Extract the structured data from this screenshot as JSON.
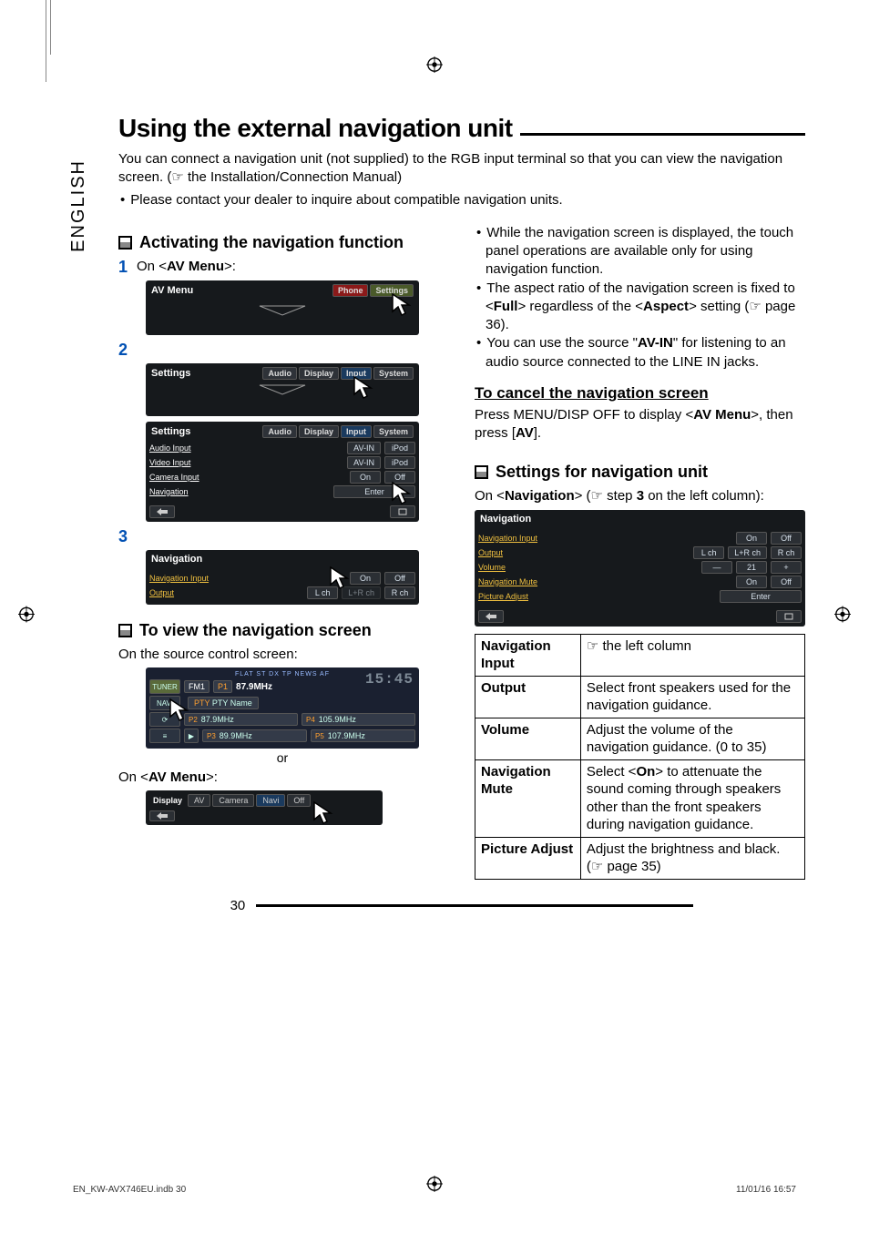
{
  "side_tab": "ENGLISH",
  "title": "Using the external navigation unit",
  "intro_line": "You can connect a navigation unit (not supplied) to the RGB input terminal so that you can view the navigation screen. (☞ the Installation/Connection Manual)",
  "intro_bullet": "Please contact your dealer to inquire about compatible navigation units.",
  "left": {
    "activating_heading": "Activating the navigation function",
    "step1_num": "1",
    "step1_text_pre": "On <",
    "step1_bold": "AV Menu",
    "step1_text_post": ">:",
    "avmenu": {
      "title": "AV Menu",
      "phone": "Phone",
      "settings": "Settings"
    },
    "step2_num": "2",
    "settings_top": {
      "title": "Settings",
      "tabs": [
        "Audio",
        "Display",
        "Input",
        "System"
      ]
    },
    "settings_input": {
      "title": "Settings",
      "tabs": [
        "Audio",
        "Display",
        "Input",
        "System"
      ],
      "rows": [
        {
          "label": "Audio Input",
          "opts": [
            "AV-IN",
            "iPod"
          ]
        },
        {
          "label": "Video Input",
          "opts": [
            "AV-IN",
            "iPod"
          ]
        },
        {
          "label": "Camera Input",
          "opts": [
            "On",
            "Off"
          ]
        },
        {
          "label": "Navigation",
          "enter": "Enter"
        }
      ]
    },
    "step3_num": "3",
    "navigation_shot": {
      "title": "Navigation",
      "rows": [
        {
          "label": "Navigation Input",
          "opts": [
            "On",
            "Off"
          ]
        },
        {
          "label": "Output",
          "opts": [
            "L ch",
            "L+R ch",
            "R ch"
          ]
        }
      ]
    },
    "view_heading": "To view the navigation screen",
    "view_intro": "On the source control screen:",
    "tuner": {
      "side": [
        "TUNER",
        "NAVI",
        "",
        ""
      ],
      "band": "FM1",
      "preset1": "P1",
      "freq_main": "87.9MHz",
      "pty": "PTY Name",
      "presets": [
        {
          "n": "P2",
          "v": "87.9MHz"
        },
        {
          "n": "P4",
          "v": "105.9MHz"
        },
        {
          "n": "P3",
          "v": "89.9MHz"
        },
        {
          "n": "P5",
          "v": "107.9MHz"
        }
      ],
      "clock": "15:45",
      "indicators": "FLAT  ST  DX  TP  NEWS  AF"
    },
    "or": "or",
    "view_avmenu_pre": "On <",
    "view_avmenu_bold": "AV Menu",
    "view_avmenu_post": ">:",
    "display_shot": {
      "label": "Display",
      "tabs": [
        "AV",
        "Camera",
        "Navi",
        "Off"
      ]
    }
  },
  "right": {
    "bullets": [
      "While the navigation screen is displayed, the touch panel operations are available only for using navigation function.",
      "The aspect ratio of the navigation screen is fixed to <__B__Full__/B__> regardless of the <__B__Aspect__/B__> setting (☞ page 36).",
      "You can use the source \"__B__AV-IN__/B__\" for listening to an audio source connected to the LINE IN jacks."
    ],
    "cancel_heading": "To cancel the navigation screen",
    "cancel_body_pre": "Press MENU/DISP OFF to display <",
    "cancel_body_bold": "AV Menu",
    "cancel_body_mid": ">, then press [",
    "cancel_body_bold2": "AV",
    "cancel_body_post": "].",
    "settings_heading": "Settings for navigation unit",
    "settings_intro_pre": "On <",
    "settings_intro_bold": "Navigation",
    "settings_intro_mid": "> (☞ step ",
    "settings_intro_bold2": "3",
    "settings_intro_post": " on the left column):",
    "nav_settings_shot": {
      "title": "Navigation",
      "rows": [
        {
          "label": "Navigation Input",
          "opts": [
            "On",
            "Off"
          ]
        },
        {
          "label": "Output",
          "opts": [
            "L ch",
            "L+R ch",
            "R ch"
          ]
        },
        {
          "label": "Volume",
          "opts": [
            "—",
            "21",
            "+"
          ]
        },
        {
          "label": "Navigation Mute",
          "opts": [
            "On",
            "Off"
          ]
        },
        {
          "label": "Picture Adjust",
          "enter": "Enter"
        }
      ]
    },
    "table": [
      {
        "k": "Navigation Input",
        "v": "☞ the left column"
      },
      {
        "k": "Output",
        "v": "Select front speakers used for the navigation guidance."
      },
      {
        "k": "Volume",
        "v": "Adjust the volume of the navigation guidance. (0 to 35)"
      },
      {
        "k": "Navigation Mute",
        "v": "Select <__B__On__/B__> to attenuate the sound coming through speakers other than the front speakers during navigation guidance."
      },
      {
        "k": "Picture Adjust",
        "v": "Adjust the brightness and black. (☞ page 35)"
      }
    ]
  },
  "page_number": "30",
  "footer_left": "EN_KW-AVX746EU.indb   30",
  "footer_right": "11/01/16   16:57"
}
